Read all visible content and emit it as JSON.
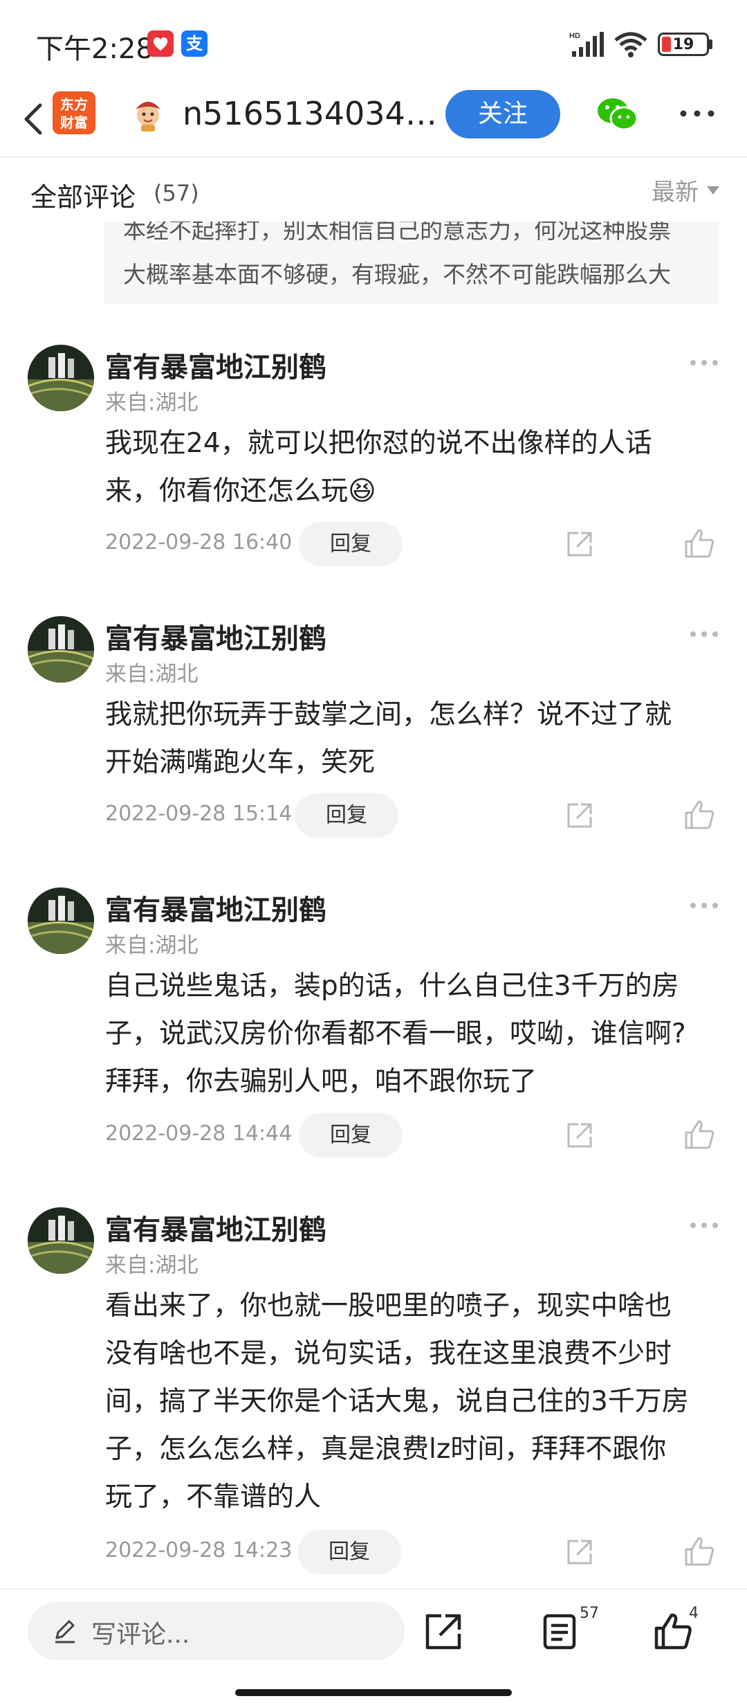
{
  "status_bar": {
    "time": "下午2:28",
    "app_icon_2": "支",
    "battery": "19",
    "battery_level": 0.19,
    "network": "HD",
    "colors": {
      "app_icon_1": "#e8333a",
      "app_icon_2": "#1677ff",
      "battery_fill": "#e53935"
    }
  },
  "header": {
    "back_icon": "chevron-left-icon",
    "brand_logo_line1": "东方",
    "brand_logo_line2": "财富",
    "title": "n51651340341...",
    "follow_label": "关注",
    "wechat_icon": "wechat-icon",
    "more_icon": "ellipsis-icon",
    "colors": {
      "brand": "#f15a22",
      "follow": "#2f7de1",
      "wechat": "#2dc100"
    }
  },
  "comments_header": {
    "title": "全部评论",
    "count": "(57)",
    "sort_label": "最新"
  },
  "quote": {
    "line1": "本经不起摔打，别太相信自己的意志力，何况这种股票",
    "line2": "大概率基本面不够硬，有瑕疵，不然不可能跌幅那么大"
  },
  "comments": [
    {
      "name": "富有暴富地江别鹤",
      "location": "来自:湖北",
      "lines": [
        "我现在24，就可以把你怼的说不出像样的人话",
        "来，你看你还怎么玩😆"
      ],
      "time": "2022-09-28 16:40",
      "reply_label": "回复"
    },
    {
      "name": "富有暴富地江别鹤",
      "location": "来自:湖北",
      "lines": [
        "我就把你玩弄于鼓掌之间，怎么样？说不过了就",
        "开始满嘴跑火车，笑死"
      ],
      "time": "2022-09-28 15:14",
      "reply_label": "回复"
    },
    {
      "name": "富有暴富地江别鹤",
      "location": "来自:湖北",
      "lines": [
        "自己说些鬼话，装p的话，什么自己住3千万的房",
        "子，说武汉房价你看都不看一眼，哎呦，谁信啊?",
        "拜拜，你去骗别人吧，咱不跟你玩了"
      ],
      "time": "2022-09-28 14:44",
      "reply_label": "回复"
    },
    {
      "name": "富有暴富地江别鹤",
      "location": "来自:湖北",
      "lines": [
        "看出来了，你也就一股吧里的喷子，现实中啥也",
        "没有啥也不是，说句实话，我在这里浪费不少时",
        "间，搞了半天你是个话大鬼，说自己住的3千万房",
        "子，怎么怎么样，真是浪费lz时间，拜拜不跟你",
        "玩了，不靠谱的人"
      ],
      "time": "2022-09-28 14:23",
      "reply_label": "回复"
    }
  ],
  "bottom_bar": {
    "input_placeholder": "写评论...",
    "comments_badge": "57",
    "likes_badge": "4"
  }
}
